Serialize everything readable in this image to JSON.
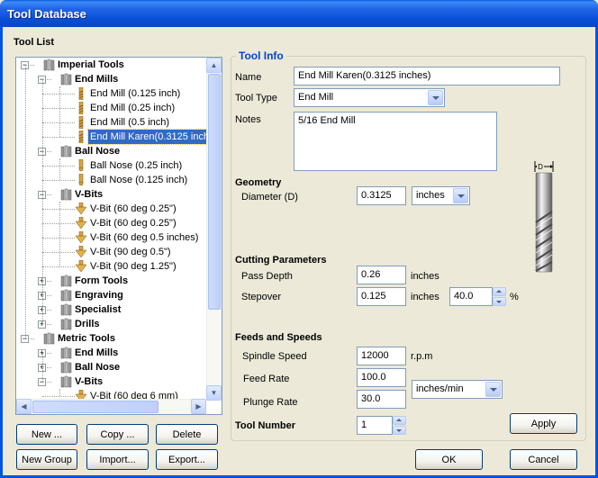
{
  "window": {
    "title": "Tool Database"
  },
  "tool_list": {
    "heading": "Tool List",
    "tree": [
      {
        "label": "Imperial Tools",
        "level": 0,
        "type": "group",
        "expanded": true
      },
      {
        "label": "End Mills",
        "level": 1,
        "type": "folder",
        "expanded": true
      },
      {
        "label": "End Mill (0.125 inch)",
        "level": 2,
        "type": "endmill"
      },
      {
        "label": "End Mill (0.25 inch)",
        "level": 2,
        "type": "endmill"
      },
      {
        "label": "End Mill (0.5 inch)",
        "level": 2,
        "type": "endmill"
      },
      {
        "label": "End Mill Karen(0.3125 inch",
        "level": 2,
        "type": "endmill",
        "selected": true
      },
      {
        "label": "Ball Nose",
        "level": 1,
        "type": "folder",
        "expanded": true
      },
      {
        "label": "Ball Nose (0.25 inch)",
        "level": 2,
        "type": "ballnose"
      },
      {
        "label": "Ball Nose (0.125 inch)",
        "level": 2,
        "type": "ballnose"
      },
      {
        "label": "V-Bits",
        "level": 1,
        "type": "folder",
        "expanded": true
      },
      {
        "label": "V-Bit (60 deg 0.25\")",
        "level": 2,
        "type": "vbit"
      },
      {
        "label": "V-Bit (60 deg 0.25\")",
        "level": 2,
        "type": "vbit"
      },
      {
        "label": "V-Bit (60 deg 0.5 inches)",
        "level": 2,
        "type": "vbit"
      },
      {
        "label": "V-Bit (90 deg 0.5\")",
        "level": 2,
        "type": "vbit"
      },
      {
        "label": "V-Bit (90 deg 1.25\")",
        "level": 2,
        "type": "vbit"
      },
      {
        "label": "Form Tools",
        "level": 1,
        "type": "folder",
        "expanded": false
      },
      {
        "label": "Engraving",
        "level": 1,
        "type": "folder",
        "expanded": false
      },
      {
        "label": "Specialist",
        "level": 1,
        "type": "folder",
        "expanded": false
      },
      {
        "label": "Drills",
        "level": 1,
        "type": "folder",
        "expanded": false
      },
      {
        "label": "Metric Tools",
        "level": 0,
        "type": "group",
        "expanded": true
      },
      {
        "label": "End Mills",
        "level": 1,
        "type": "folder",
        "expanded": false
      },
      {
        "label": "Ball Nose",
        "level": 1,
        "type": "folder",
        "expanded": false
      },
      {
        "label": "V-Bits",
        "level": 1,
        "type": "folder",
        "expanded": true
      },
      {
        "label": "V-Bit (60 deg 6 mm)",
        "level": 2,
        "type": "vbit"
      }
    ],
    "buttons": {
      "new": "New ...",
      "copy": "Copy ...",
      "delete": "Delete",
      "new_group": "New Group",
      "import": "Import...",
      "export": "Export..."
    }
  },
  "tool_info": {
    "heading": "Tool Info",
    "name_label": "Name",
    "name_value": "End Mill Karen(0.3125 inches)",
    "type_label": "Tool Type",
    "type_value": "End Mill",
    "notes_label": "Notes",
    "notes_value": "5/16 End Mill",
    "diagram_label": "D",
    "geometry": {
      "heading": "Geometry",
      "diameter_label": "Diameter (D)",
      "diameter_value": "0.3125",
      "units_value": "inches"
    },
    "cutting": {
      "heading": "Cutting Parameters",
      "pass_depth_label": "Pass Depth",
      "pass_depth_value": "0.26",
      "pass_depth_unit": "inches",
      "stepover_label": "Stepover",
      "stepover_value": "0.125",
      "stepover_unit": "inches",
      "stepover_percent": "40.0",
      "percent_sign": "%"
    },
    "feeds": {
      "heading": "Feeds and Speeds",
      "spindle_label": "Spindle Speed",
      "spindle_value": "12000",
      "spindle_unit": "r.p.m",
      "feed_label": "Feed Rate",
      "feed_value": "100.0",
      "plunge_label": "Plunge Rate",
      "plunge_value": "30.0",
      "rate_units": "inches/min"
    },
    "tool_number_label": "Tool Number",
    "tool_number_value": "1",
    "apply": "Apply"
  },
  "footer": {
    "ok": "OK",
    "cancel": "Cancel"
  },
  "colors": {
    "selection": "#316ac5",
    "group_title": "#0046d5",
    "titlebar": "#0054e3"
  }
}
